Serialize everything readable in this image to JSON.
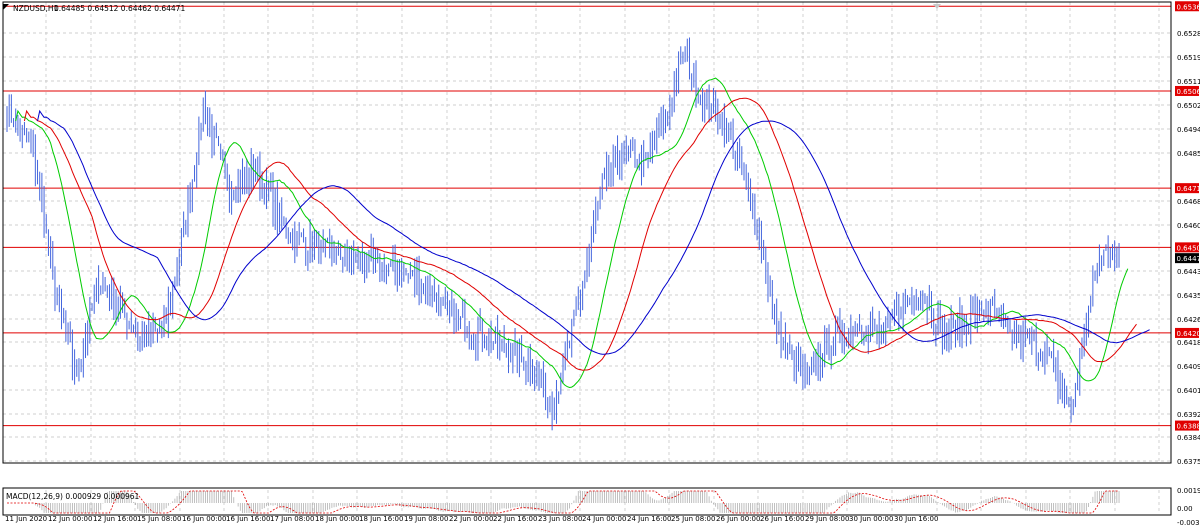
{
  "header": {
    "symbol": "NZDUSD,H1",
    "ohlc": "0.64485 0.64512 0.64462 0.64471",
    "macd_label": "MACD(12,26,9) 0.000929 0.000961"
  },
  "chart_data": {
    "type": "candlestick",
    "symbol": "NZDUSD",
    "timeframe": "H1",
    "ylim": [
      0.63755,
      0.65375
    ],
    "y_ticks": [
      "0.65280",
      "0.65195",
      "0.65110",
      "0.65025",
      "0.64940",
      "0.64855",
      "0.64680",
      "0.64600",
      "0.64435",
      "0.64350",
      "0.64265",
      "0.64180",
      "0.64095",
      "0.64010",
      "0.63925",
      "0.63840",
      "0.63755"
    ],
    "x_ticks": [
      "11 Jun 2020",
      "12 Jun 00:00",
      "12 Jun 16:00",
      "15 Jun 08:00",
      "16 Jun 00:00",
      "16 Jun 16:00",
      "17 Jun 08:00",
      "18 Jun 00:00",
      "18 Jun 16:00",
      "19 Jun 08:00",
      "22 Jun 00:00",
      "22 Jun 16:00",
      "23 Jun 08:00",
      "24 Jun 00:00",
      "24 Jun 16:00",
      "25 Jun 08:00",
      "26 Jun 00:00",
      "26 Jun 16:00",
      "29 Jun 08:00",
      "30 Jun 00:00",
      "30 Jun 16:00"
    ],
    "horizontal_levels": [
      {
        "value": 0.6536,
        "label": "0.65360",
        "color": "#e00000"
      },
      {
        "value": 0.65061,
        "label": "0.65061",
        "color": "#e00000"
      },
      {
        "value": 0.64718,
        "label": "0.64718",
        "color": "#e00000"
      },
      {
        "value": 0.64509,
        "label": "0.64509",
        "color": "#e00000"
      },
      {
        "value": 0.64207,
        "label": "0.64207",
        "color": "#e00000"
      },
      {
        "value": 0.6388,
        "label": "0.63880",
        "color": "#e00000"
      }
    ],
    "current_price": {
      "value": 0.64471,
      "label": "0.64471"
    },
    "close_keypoints": [
      [
        0,
        0.65
      ],
      [
        12,
        0.6485
      ],
      [
        22,
        0.6435
      ],
      [
        32,
        0.6405
      ],
      [
        42,
        0.644
      ],
      [
        52,
        0.643
      ],
      [
        62,
        0.6418
      ],
      [
        72,
        0.6422
      ],
      [
        82,
        0.646
      ],
      [
        90,
        0.65
      ],
      [
        102,
        0.6472
      ],
      [
        114,
        0.6478
      ],
      [
        130,
        0.6455
      ],
      [
        150,
        0.6448
      ],
      [
        170,
        0.6445
      ],
      [
        188,
        0.644
      ],
      [
        206,
        0.6425
      ],
      [
        222,
        0.6418
      ],
      [
        240,
        0.641
      ],
      [
        250,
        0.6395
      ],
      [
        262,
        0.643
      ],
      [
        272,
        0.647
      ],
      [
        282,
        0.6485
      ],
      [
        292,
        0.648
      ],
      [
        302,
        0.6495
      ],
      [
        310,
        0.652
      ],
      [
        318,
        0.6505
      ],
      [
        326,
        0.6498
      ],
      [
        334,
        0.6485
      ],
      [
        344,
        0.646
      ],
      [
        352,
        0.6425
      ],
      [
        360,
        0.641
      ],
      [
        368,
        0.6405
      ],
      [
        378,
        0.6418
      ],
      [
        390,
        0.6424
      ],
      [
        402,
        0.642
      ],
      [
        412,
        0.6432
      ],
      [
        420,
        0.6435
      ],
      [
        430,
        0.642
      ],
      [
        440,
        0.6425
      ],
      [
        450,
        0.643
      ],
      [
        460,
        0.642
      ],
      [
        470,
        0.6418
      ],
      [
        478,
        0.6412
      ],
      [
        484,
        0.64
      ],
      [
        488,
        0.6392
      ],
      [
        494,
        0.642
      ],
      [
        500,
        0.6445
      ],
      [
        506,
        0.6452
      ],
      [
        510,
        0.6447
      ]
    ],
    "moving_averages": [
      {
        "color": "#00cc00",
        "period": 8
      },
      {
        "color": "#e00000",
        "period": 16
      },
      {
        "color": "#0000cc",
        "period": 28
      }
    ],
    "macd": {
      "params": "12,26,9",
      "main": 0.000929,
      "signal": 0.000961,
      "ylim": [
        -0.003,
        0.00196
      ],
      "y_ticks": [
        "0.00196",
        "0.00",
        "-0.00301"
      ]
    }
  },
  "colors": {
    "candle": "#4466dd",
    "grid": "#c0c0c0",
    "level": "#e00000",
    "macd_hist": "#b0b0b0",
    "macd_signal": "#e00000"
  }
}
